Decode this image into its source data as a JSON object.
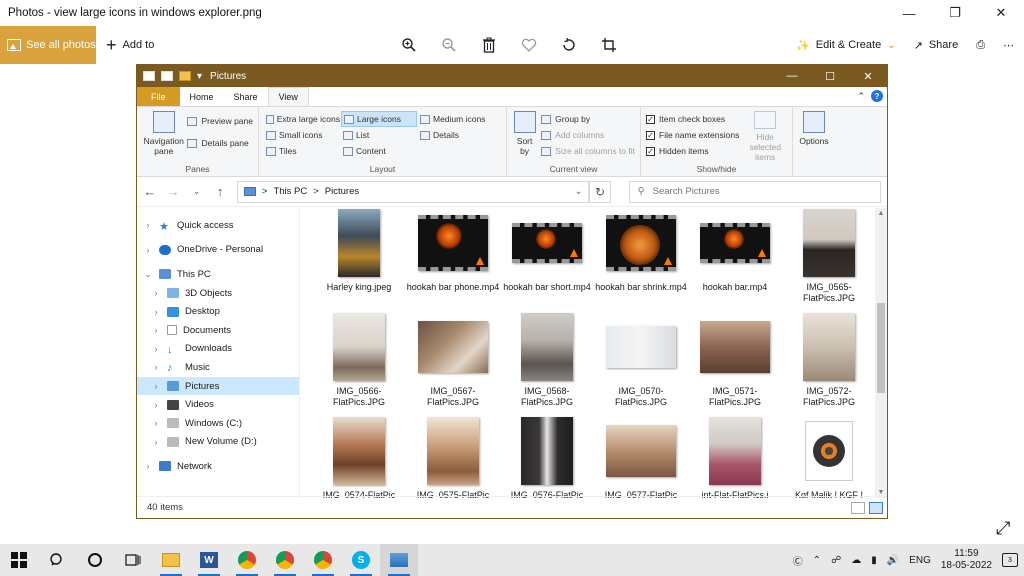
{
  "photos": {
    "title": "Photos - view large icons in windows explorer.png",
    "see_all": "See all photos",
    "add_to": "Add to",
    "edit_create": "Edit & Create",
    "share": "Share"
  },
  "explorer": {
    "title": "Pictures",
    "tabs": [
      "File",
      "Home",
      "Share",
      "View"
    ],
    "ribbon": {
      "panes": {
        "nav_pane": "Navigation pane",
        "preview": "Preview pane",
        "details": "Details pane",
        "label": "Panes"
      },
      "layout": {
        "items": [
          "Extra large icons",
          "Large icons",
          "Medium icons",
          "Small icons",
          "List",
          "Details",
          "Tiles",
          "Content"
        ],
        "label": "Layout"
      },
      "current_view": {
        "sort_by": "Sort by",
        "group_by": "Group by",
        "add_columns": "Add columns",
        "size_all": "Size all columns to fit",
        "label": "Current view"
      },
      "show_hide": {
        "item_check": "Item check boxes",
        "file_ext": "File name extensions",
        "hidden": "Hidden items",
        "hide_selected": "Hide selected items",
        "label": "Show/hide"
      },
      "options": "Options"
    },
    "address": {
      "this_pc": "This PC",
      "sep": ">",
      "pictures": "Pictures",
      "search_placeholder": "Search Pictures"
    },
    "nav": [
      {
        "label": "Quick access",
        "indent": 0
      },
      {
        "label": "OneDrive - Personal",
        "indent": 0
      },
      {
        "label": "This PC",
        "indent": 0
      },
      {
        "label": "3D Objects",
        "indent": 1
      },
      {
        "label": "Desktop",
        "indent": 1
      },
      {
        "label": "Documents",
        "indent": 1
      },
      {
        "label": "Downloads",
        "indent": 1
      },
      {
        "label": "Music",
        "indent": 1
      },
      {
        "label": "Pictures",
        "indent": 1
      },
      {
        "label": "Videos",
        "indent": 1
      },
      {
        "label": "Windows (C:)",
        "indent": 1
      },
      {
        "label": "New Volume (D:)",
        "indent": 1
      },
      {
        "label": "Network",
        "indent": 0
      }
    ],
    "files": [
      {
        "name": "Harley king.jpeg",
        "kind": "photo"
      },
      {
        "name": "hookah bar phone.mp4",
        "kind": "video"
      },
      {
        "name": "hookah bar short.mp4",
        "kind": "video"
      },
      {
        "name": "hookah bar shrink.mp4",
        "kind": "video"
      },
      {
        "name": "hookah bar.mp4",
        "kind": "video"
      },
      {
        "name": "IMG_0565-FlatPics.JPG",
        "kind": "photo"
      },
      {
        "name": "IMG_0566-FlatPics.JPG",
        "kind": "photo"
      },
      {
        "name": "IMG_0567-FlatPics.JPG",
        "kind": "photo"
      },
      {
        "name": "IMG_0568-FlatPics.JPG",
        "kind": "photo"
      },
      {
        "name": "IMG_0570-FlatPics.JPG",
        "kind": "photo"
      },
      {
        "name": "IMG_0571-FlatPics.JPG",
        "kind": "photo"
      },
      {
        "name": "IMG_0572-FlatPics.JPG",
        "kind": "photo"
      },
      {
        "name": "IMG_0574-FlatPic",
        "kind": "photo"
      },
      {
        "name": "IMG_0575-FlatPic",
        "kind": "photo"
      },
      {
        "name": "IMG_0576-FlatPic",
        "kind": "photo"
      },
      {
        "name": "IMG_0577-FlatPic",
        "kind": "photo"
      },
      {
        "name": "int-Flat-FlatPics.j",
        "kind": "photo"
      },
      {
        "name": "Kgf Malik ! KGF !",
        "kind": "audio"
      }
    ],
    "status": "40 items"
  },
  "taskbar": {
    "lang": "ENG",
    "time": "11:59",
    "date": "18-05-2022",
    "notifications": "3"
  }
}
